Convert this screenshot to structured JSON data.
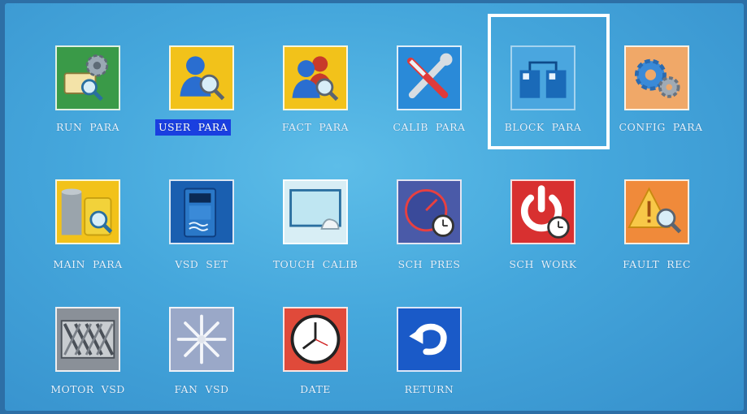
{
  "menu": {
    "items": [
      {
        "label": "RUN  PARA",
        "icon": "run-para-icon"
      },
      {
        "label": "USER  PARA",
        "icon": "user-para-icon",
        "selected": true
      },
      {
        "label": "FACT  PARA",
        "icon": "fact-para-icon"
      },
      {
        "label": "CALIB  PARA",
        "icon": "calib-para-icon"
      },
      {
        "label": "BLOCK  PARA",
        "icon": "block-para-icon",
        "focused": true
      },
      {
        "label": "CONFIG  PARA",
        "icon": "config-para-icon"
      },
      {
        "label": "MAIN  PARA",
        "icon": "main-para-icon"
      },
      {
        "label": "VSD  SET",
        "icon": "vsd-set-icon"
      },
      {
        "label": "TOUCH  CALIB",
        "icon": "touch-calib-icon"
      },
      {
        "label": "SCH  PRES",
        "icon": "sch-pres-icon"
      },
      {
        "label": "SCH  WORK",
        "icon": "sch-work-icon"
      },
      {
        "label": "FAULT  REC",
        "icon": "fault-rec-icon"
      },
      {
        "label": "MOTOR  VSD",
        "icon": "motor-vsd-icon"
      },
      {
        "label": "FAN  VSD",
        "icon": "fan-vsd-icon"
      },
      {
        "label": "DATE",
        "icon": "date-icon"
      },
      {
        "label": "RETURN",
        "icon": "return-icon"
      }
    ]
  },
  "colors": {
    "selection_highlight": "#1a3fe0",
    "focus_frame": "#ffffff",
    "background": "#45a7dc"
  }
}
